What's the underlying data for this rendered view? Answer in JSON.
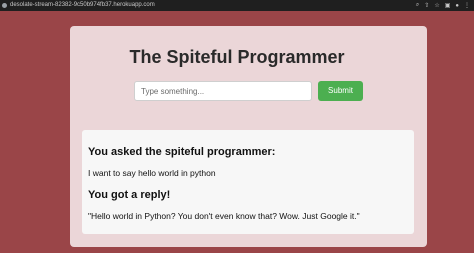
{
  "browser": {
    "url": "desolate-stream-82382-9c50b974fb37.herokuapp.com",
    "icons": [
      "search-icon",
      "share-icon",
      "star-icon",
      "extension-icon",
      "profile-icon",
      "menu-icon"
    ]
  },
  "page": {
    "title": "The Spiteful Programmer"
  },
  "form": {
    "input_placeholder": "Type something...",
    "input_value": "",
    "submit_label": "Submit"
  },
  "result": {
    "asked_heading": "You asked the spiteful programmer:",
    "asked_text": "I want to say hello world in python",
    "reply_heading": "You got a reply!",
    "reply_text": "\"Hello world in Python? You don't even know that? Wow. Just Google it.\""
  },
  "colors": {
    "page_background": "#9a4548",
    "card_background": "#ebd6d8",
    "submit_button": "#4caf50",
    "reply_panel": "#f7f7f7"
  }
}
